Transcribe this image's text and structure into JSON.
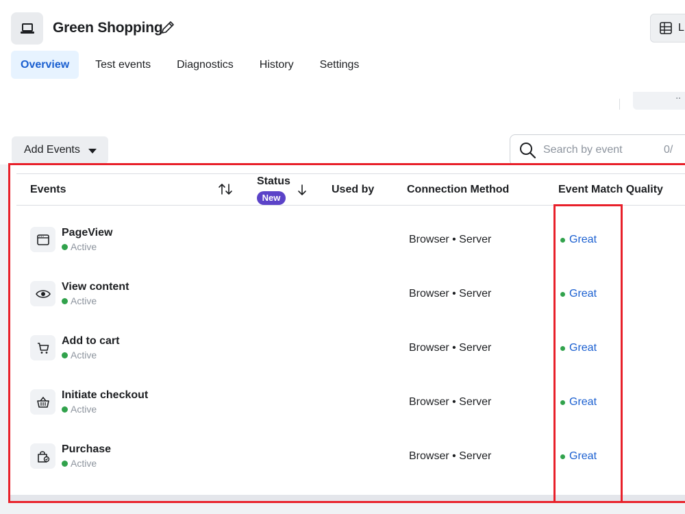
{
  "header": {
    "title": "Green Shopping",
    "top_right_button_label": "L",
    "tabs": [
      {
        "label": "Overview",
        "active": true
      },
      {
        "label": "Test events",
        "active": false
      },
      {
        "label": "Diagnostics",
        "active": false
      },
      {
        "label": "History",
        "active": false
      },
      {
        "label": "Settings",
        "active": false
      }
    ]
  },
  "strip": {
    "button_label": ".."
  },
  "toolbar": {
    "add_events_label": "Add Events",
    "search_placeholder": "Search by event",
    "search_count": "0/"
  },
  "table": {
    "columns": {
      "events": "Events",
      "status": "Status",
      "status_badge": "New",
      "used_by": "Used by",
      "connection_method": "Connection Method",
      "event_match_quality": "Event Match Quality"
    },
    "rows": [
      {
        "name": "PageView",
        "status": "Active",
        "icon": "browser-window-icon",
        "connection": "Browser • Server",
        "quality": "Great"
      },
      {
        "name": "View content",
        "status": "Active",
        "icon": "eye-icon",
        "connection": "Browser • Server",
        "quality": "Great"
      },
      {
        "name": "Add to cart",
        "status": "Active",
        "icon": "cart-icon",
        "connection": "Browser • Server",
        "quality": "Great"
      },
      {
        "name": "Initiate checkout",
        "status": "Active",
        "icon": "basket-icon",
        "connection": "Browser • Server",
        "quality": "Great"
      },
      {
        "name": "Purchase",
        "status": "Active",
        "icon": "shopping-bag-icon",
        "connection": "Browser • Server",
        "quality": "Great"
      }
    ]
  },
  "colors": {
    "accent": "#1a5fd0",
    "active_tab_bg": "#e7f3ff",
    "status_green": "#31a24c",
    "badge_purple": "#5b43c8",
    "highlight_red": "#e8202a"
  }
}
